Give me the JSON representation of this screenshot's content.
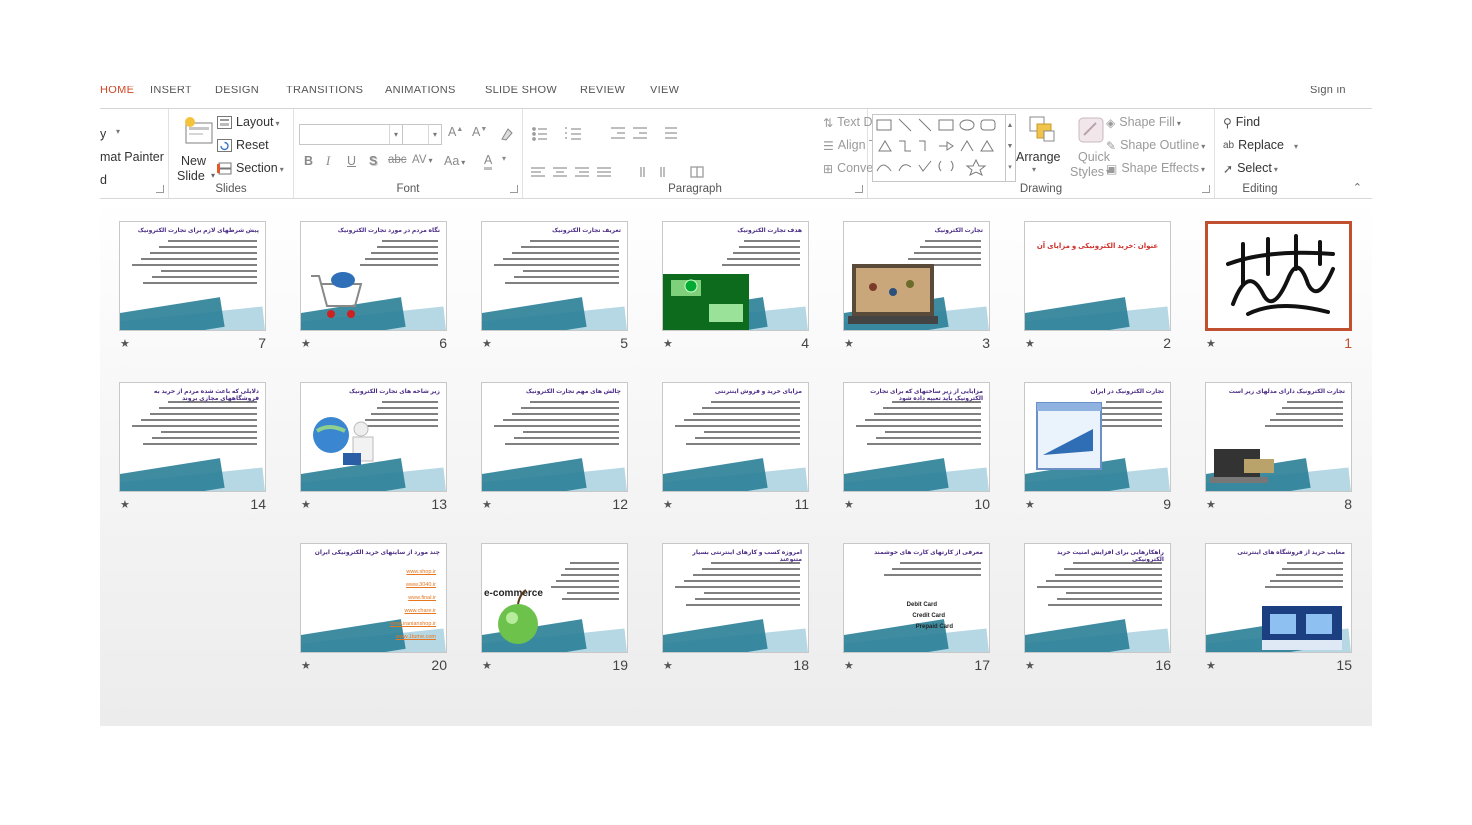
{
  "tabs": [
    "HOME",
    "INSERT",
    "DESIGN",
    "TRANSITIONS",
    "ANIMATIONS",
    "SLIDE SHOW",
    "REVIEW",
    "VIEW"
  ],
  "account": "Sign in",
  "ribbon": {
    "clipboard": {
      "paste_fragment": "y",
      "format_painter": "mat Painter",
      "tail": "d"
    },
    "slides": {
      "new_slide_line1": "New",
      "new_slide_line2": "Slide",
      "layout": "Layout",
      "reset": "Reset",
      "section": "Section",
      "label": "Slides"
    },
    "font": {
      "label": "Font",
      "bold": "B",
      "italic": "I",
      "underline": "U",
      "shadow": "S",
      "strike": "abc",
      "spacing": "AV",
      "case": "Aa",
      "color": "A"
    },
    "paragraph": {
      "label": "Paragraph",
      "text_direction": "Text Direction",
      "align_text": "Align Text",
      "convert_smartart": "Convert to SmartArt"
    },
    "drawing": {
      "label": "Drawing",
      "arrange": "Arrange",
      "quick_styles_line1": "Quick",
      "quick_styles_line2": "Styles",
      "shape_fill": "Shape Fill",
      "shape_outline": "Shape Outline",
      "shape_effects": "Shape Effects"
    },
    "editing": {
      "label": "Editing",
      "find": "Find",
      "replace": "Replace",
      "select": "Select"
    }
  },
  "slides": [
    {
      "number": "1",
      "title": "",
      "selected": true,
      "kind": "calligraphy"
    },
    {
      "number": "2",
      "title": "عنوان :خرید الکترونیکی و مزایای آن",
      "kind": "title"
    },
    {
      "number": "3",
      "title": "تجارت الکترونیک",
      "kind": "photo"
    },
    {
      "number": "4",
      "title": "هدف تجارت الکترونیک",
      "kind": "green"
    },
    {
      "number": "5",
      "title": "تعریف تجارت الکترونیک",
      "kind": "text"
    },
    {
      "number": "6",
      "title": "نگاه مردم در مورد تجارت الکترونیک",
      "kind": "cart"
    },
    {
      "number": "7",
      "title": "پیش شرطهای لازم برای تجارت الکترونیک",
      "kind": "text"
    },
    {
      "number": "8",
      "title": "تجارت الکترونیک دارای مدلهای زیر است",
      "kind": "laptop"
    },
    {
      "number": "9",
      "title": "تجارت الکترونیک در ایران",
      "kind": "browser"
    },
    {
      "number": "10",
      "title": "مزایایی از زیر ساختهای که برای تجارت الکترونیک باید تعبیه داده شود",
      "kind": "text"
    },
    {
      "number": "11",
      "title": "مزایای خرید و فروش اینترنتی",
      "kind": "text"
    },
    {
      "number": "12",
      "title": "چالش های مهم تجارت الکترونیک",
      "kind": "text"
    },
    {
      "number": "13",
      "title": "زیر شاخه های تجارت الکترونیک",
      "kind": "globe"
    },
    {
      "number": "14",
      "title": "دلایلی که باعث شده مردم از خرید به فروشگاههای مجازی بروند",
      "kind": "text"
    },
    {
      "number": "15",
      "title": "معایب خرید از فروشگاه های اینترنتی",
      "kind": "screen"
    },
    {
      "number": "16",
      "title": "راهکارهایی برای افزایش امنیت خرید الکترونیکی",
      "kind": "text"
    },
    {
      "number": "17",
      "title": "معرفی از کارتهای کارت های خوشمند",
      "kind": "cards"
    },
    {
      "number": "18",
      "title": "امروزه کسب و کارهای اینترنتی بسیار متنوعند",
      "kind": "text"
    },
    {
      "number": "19",
      "title": "",
      "kind": "apple"
    },
    {
      "number": "20",
      "title": "چند مورد از سایتهای خرید الکترونیکی ایران",
      "kind": "links"
    }
  ],
  "slide_texts": {
    "slide19_logo": "e-commerce",
    "slide17_card1": "Debit Card",
    "slide17_card2": "Credit Card",
    "slide17_card3": "Prepaid Card"
  },
  "links20": [
    "www.shop.ir",
    "www.3040.ir",
    "www.final.ir",
    "www.chare.ir",
    "www.iranianshop.ir",
    "www.1tume.com"
  ],
  "accent_color": "#c0502f"
}
